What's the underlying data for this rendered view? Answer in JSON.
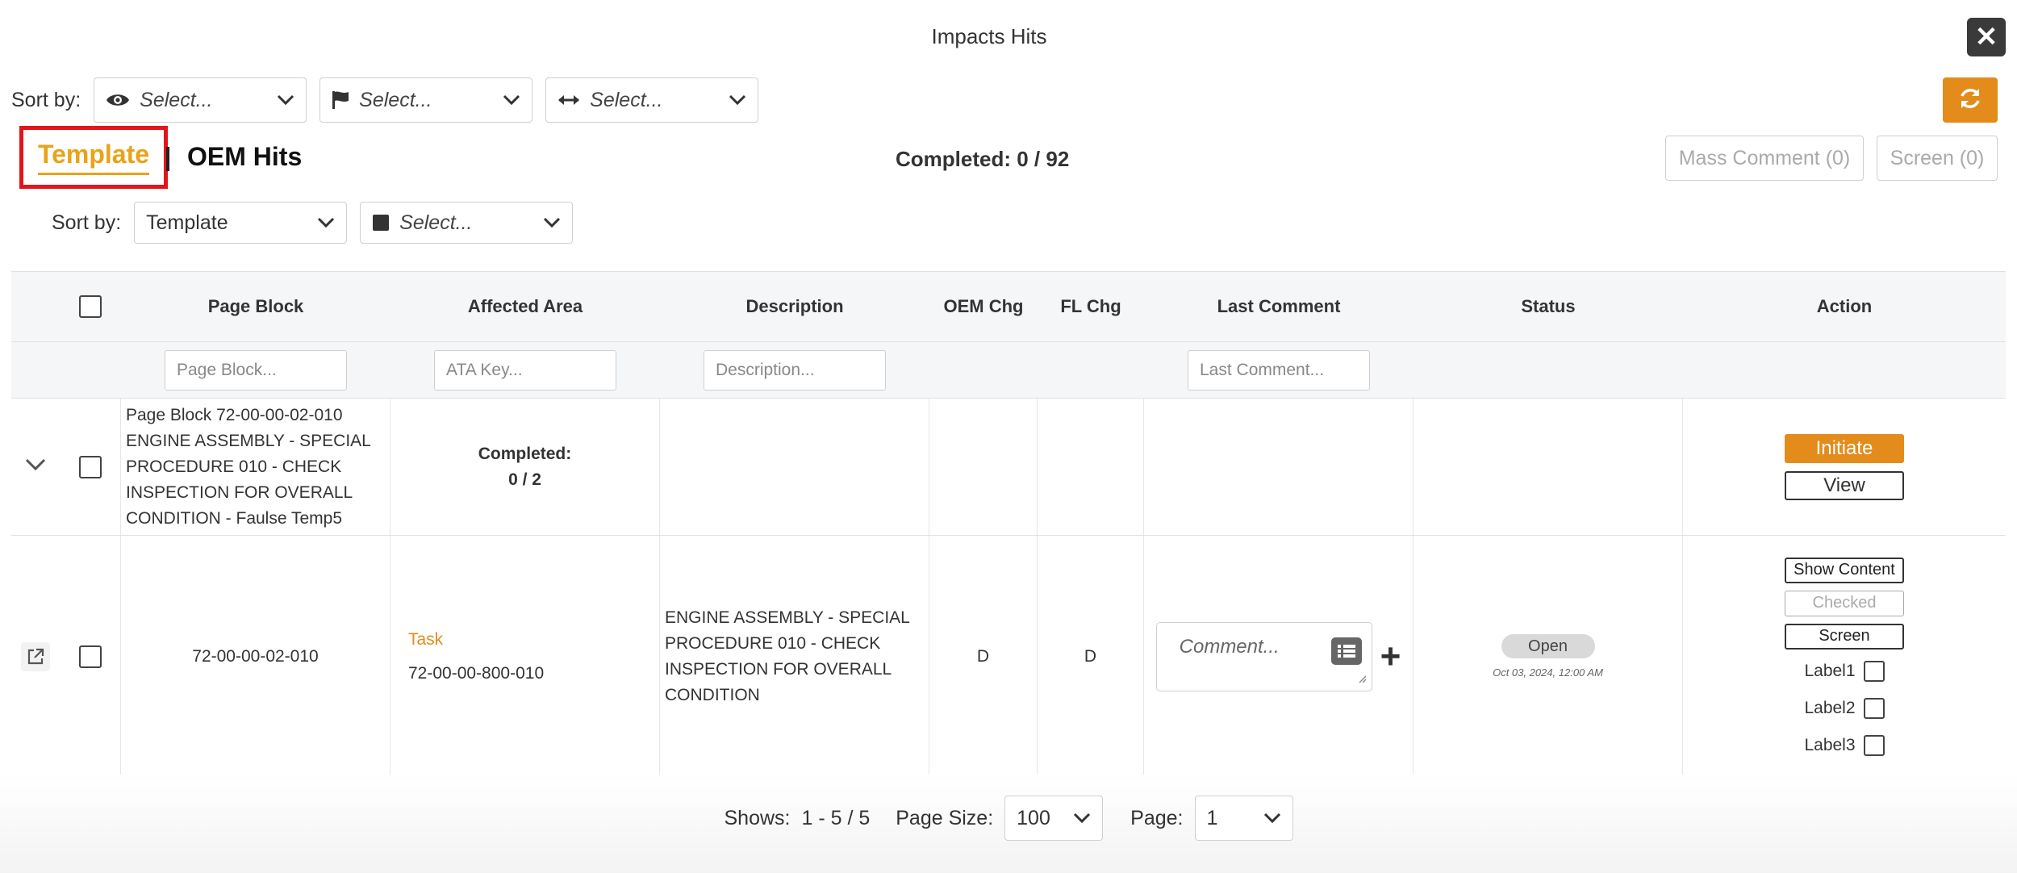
{
  "modal": {
    "title": "Impacts Hits"
  },
  "sortbar": {
    "label": "Sort by:",
    "selects": [
      {
        "placeholder": "Select...",
        "icon": "eye-icon"
      },
      {
        "placeholder": "Select...",
        "icon": "flag-icon"
      },
      {
        "placeholder": "Select...",
        "icon": "arrows-horizontal-icon"
      }
    ]
  },
  "tabs": {
    "active": "Template",
    "other": "OEM Hits"
  },
  "progress": {
    "label": "Completed:",
    "value": "0 / 92"
  },
  "actions": {
    "mass_comment": "Mass Comment (0)",
    "screen": "Screen (0)"
  },
  "sortbar2": {
    "label": "Sort by:",
    "sort_value": "Template",
    "color_placeholder": "Select..."
  },
  "table": {
    "headers": [
      "Page Block",
      "Affected Area",
      "Description",
      "OEM Chg",
      "FL Chg",
      "Last Comment",
      "Status",
      "Action"
    ],
    "filters": {
      "page_block": "Page Block...",
      "ata_key": "ATA Key...",
      "description": "Description...",
      "last_comment": "Last Comment..."
    },
    "group": {
      "page_block": "Page Block 72-00-00-02-010 ENGINE ASSEMBLY - SPECIAL PROCEDURE 010 - CHECK INSPECTION FOR OVERALL CONDITION - Faulse Temp5",
      "completed_label": "Completed:",
      "completed_value": "0 / 2",
      "initiate": "Initiate",
      "view": "View"
    },
    "item": {
      "page_block": "72-00-00-02-010",
      "type": "Task",
      "ata": "72-00-00-800-010",
      "description": "ENGINE ASSEMBLY - SPECIAL PROCEDURE 010 - CHECK INSPECTION FOR OVERALL CONDITION",
      "oem_chg": "D",
      "fl_chg": "D",
      "comment_placeholder": "Comment...",
      "status": "Open",
      "status_date": "Oct 03, 2024, 12:00 AM",
      "buttons": {
        "show_content": "Show Content",
        "checked": "Checked",
        "screen": "Screen"
      },
      "labels": [
        "Label1",
        "Label2",
        "Label3"
      ]
    }
  },
  "footer": {
    "shows_label": "Shows:",
    "shows_value": "1 - 5 / 5",
    "page_size_label": "Page Size:",
    "page_size": "100",
    "page_label": "Page:",
    "page": "1"
  },
  "colors": {
    "accent": "#e38c1c",
    "tab_active": "#e8a317",
    "highlight": "#e3151a"
  }
}
